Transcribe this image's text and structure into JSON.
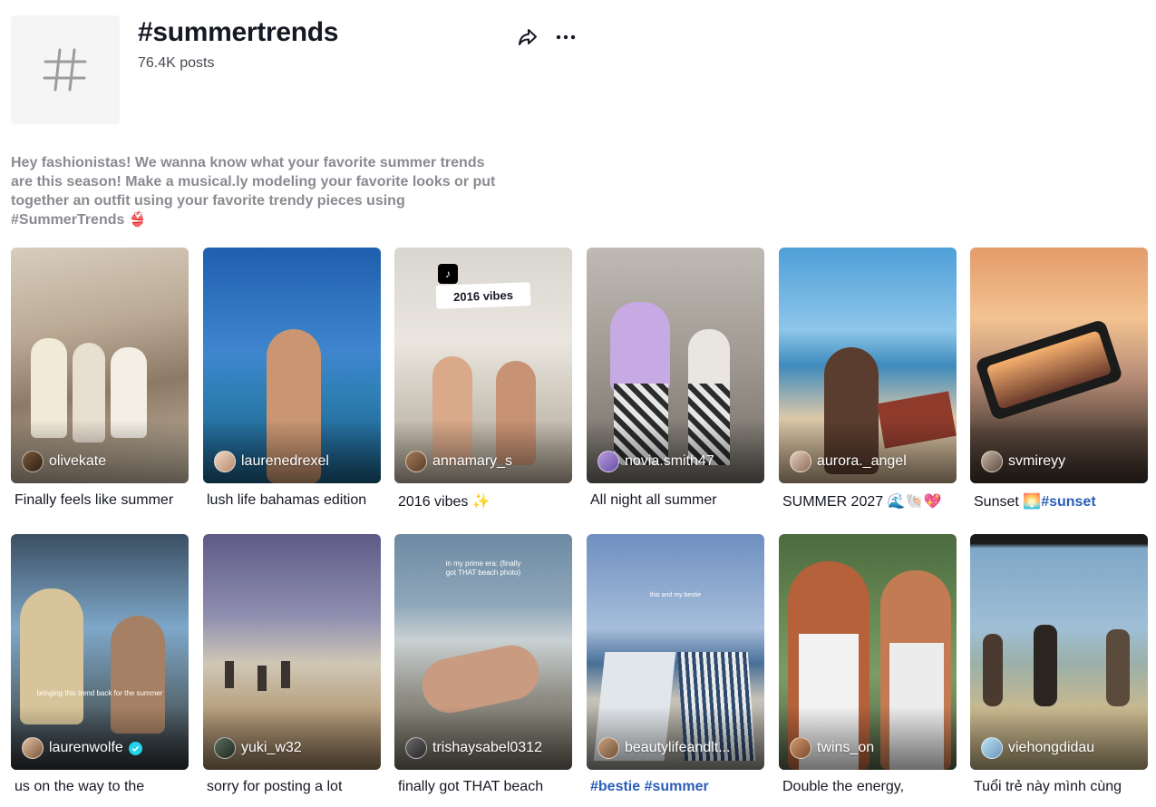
{
  "header": {
    "title": "#summertrends",
    "post_count": "76.4K posts",
    "description": "Hey fashionistas! We wanna know what your favorite summer trends are this season! Make a musical.ly modeling your favorite looks or put together an outfit using your favorite trendy pieces using #SummerTrends 👙"
  },
  "icons": {
    "tag": "hashtag-icon",
    "share": "share-arrow-icon",
    "more": "more-dots-icon"
  },
  "videos": [
    {
      "username": "olivekate",
      "caption": "Finally feels like summer"
    },
    {
      "username": "laurenedrexel",
      "caption": "lush life bahamas edition"
    },
    {
      "username": "annamary_s",
      "caption": "2016 vibes ✨",
      "sticker": "2016 vibes"
    },
    {
      "username": "novia.smith47",
      "caption": "All night all summer"
    },
    {
      "username": "aurora._angel",
      "caption": "SUMMER 2027 🌊🐚💖"
    },
    {
      "username": "svmireyy",
      "caption": "Sunset 🌅",
      "caption_tag": "#sunset"
    },
    {
      "username": "laurenwolfe",
      "caption": "us on the way to the",
      "overlay": "bringing this trend back for the summer"
    },
    {
      "username": "yuki_w32",
      "caption": "sorry for posting a lot"
    },
    {
      "username": "trishaysabel0312",
      "caption": "finally got THAT beach",
      "overlay": "in my prime era: (finally got THAT beach photo)"
    },
    {
      "username": "beautylifeandlt...",
      "caption": "",
      "caption_tag": "#bestie #summer",
      "overlay": "this and my bestie"
    },
    {
      "username": "twins_on",
      "caption": "Double the energy,"
    },
    {
      "username": "viehongdidau",
      "caption": "Tuổi trẻ này mình cùng"
    }
  ]
}
